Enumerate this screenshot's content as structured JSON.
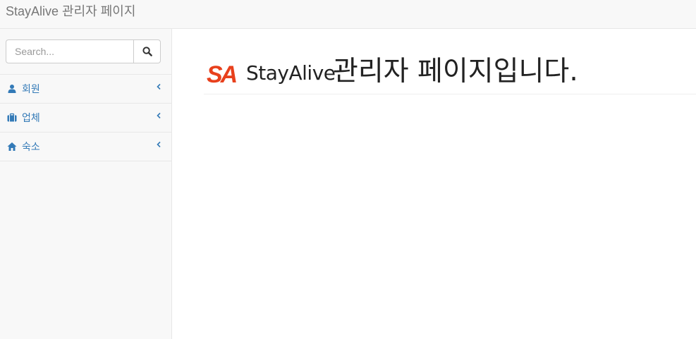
{
  "navbar": {
    "brand": "StayAlive 관리자 페이지"
  },
  "sidebar": {
    "search": {
      "placeholder": "Search...",
      "value": "",
      "button_icon": "search-icon"
    },
    "items": [
      {
        "label": "회원",
        "icon": "user-icon",
        "chevron": "chevron-left-icon"
      },
      {
        "label": "업체",
        "icon": "briefcase-icon",
        "chevron": "chevron-left-icon"
      },
      {
        "label": "숙소",
        "icon": "home-icon",
        "chevron": "chevron-left-icon"
      }
    ]
  },
  "main": {
    "logo_mark": "SA",
    "logo_text": "StayAlive",
    "title": "관리자 페이지입니다."
  },
  "colors": {
    "link": "#337ab7",
    "logo_red": "#e8401c",
    "navbar_bg": "#f8f8f8",
    "brand_text": "#777777"
  }
}
